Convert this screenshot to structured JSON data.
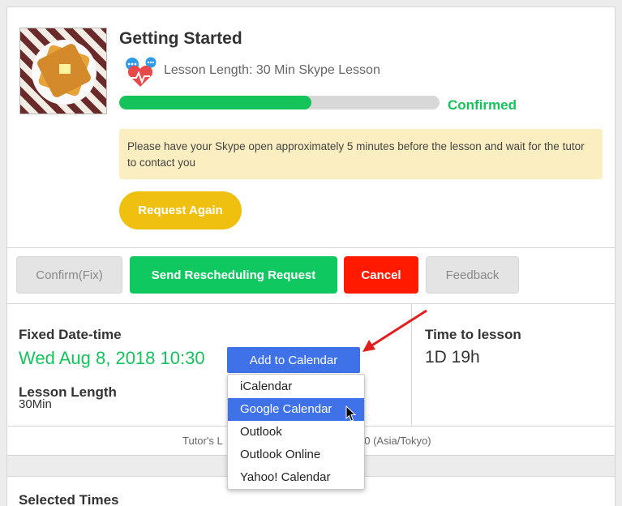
{
  "lesson": {
    "title": "Getting Started",
    "length_label": "Lesson Length: 30 Min Skype Lesson",
    "progress_percent": 60,
    "status": "Confirmed",
    "notice": "Please have your Skype open approximately 5 minutes before the lesson and wait for the tutor to contact you",
    "request_again_label": "Request Again"
  },
  "actions": {
    "confirm_label": "Confirm(Fix)",
    "reschedule_label": "Send Rescheduling Request",
    "cancel_label": "Cancel",
    "feedback_label": "Feedback"
  },
  "schedule": {
    "fixed_label": "Fixed Date-time",
    "fixed_value": "Wed Aug 8, 2018 10:30",
    "length_label": "Lesson Length",
    "length_value": "30Min",
    "time_to_label": "Time to lesson",
    "time_to_value": "1D 19h",
    "add_calendar_label": "Add to Calendar",
    "timezone_left": "Tutor's L",
    "timezone_right": "30 (Asia/Tokyo)"
  },
  "calendar_menu": {
    "items": [
      "iCalendar",
      "Google Calendar",
      "Outlook",
      "Outlook Online",
      "Yahoo! Calendar"
    ],
    "active_index": 1
  },
  "selected_times_label": "Selected Times",
  "colors": {
    "accent_green": "#15c35b",
    "cancel_red": "#ff1a00",
    "calendar_blue": "#3f72e8",
    "request_yellow": "#f0c010",
    "notice_bg": "#fbeec0"
  }
}
